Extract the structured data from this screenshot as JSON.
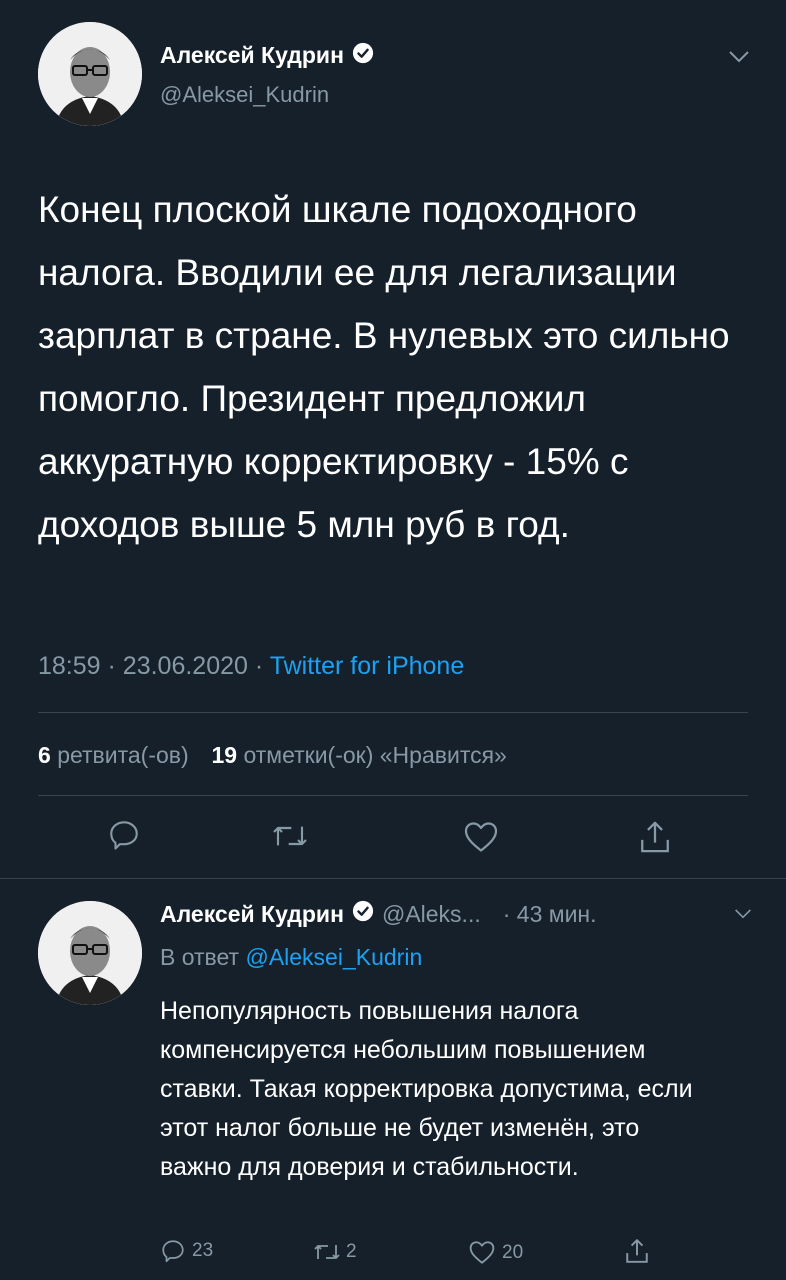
{
  "main_tweet": {
    "author_name": "Алексей Кудрин",
    "handle": "@Aleksei_Kudrin",
    "text": "Конец плоской шкале подоходного налога. Вводили ее для легализации зарплат в стране. В нулевых это сильно помогло. Президент предложил аккуратную корректировку - 15% с доходов выше 5 млн руб в год.",
    "time": "18:59",
    "date": "23.06.2020",
    "source": "Twitter for iPhone",
    "retweet_count": "6",
    "retweet_label": "ретвита(-ов)",
    "like_count": "19",
    "like_label": "отметки(-ок) «Нравится»"
  },
  "reply_tweet": {
    "author_name": "Алексей Кудрин",
    "handle": "@Aleks...",
    "time_ago": "· 43 мин.",
    "reply_to_prefix": "В ответ",
    "reply_to_handle": "@Aleksei_Kudrin",
    "text": "Непопулярность повышения налога компенсируется небольшим повышением ставки. Такая корректировка допустима, если этот налог больше не будет изменён, это важно для доверия и стабильности.",
    "reply_count": "23",
    "retweet_count": "2",
    "like_count": "20"
  },
  "icons": {
    "verified": "verified-badge-icon",
    "chevron": "chevron-down-icon",
    "reply": "reply-icon",
    "retweet": "retweet-icon",
    "like": "heart-icon",
    "share": "share-icon"
  },
  "colors": {
    "background": "#15202b",
    "text": "#ffffff",
    "muted": "#8899a6",
    "link": "#1da1f2",
    "divider": "#38444d"
  }
}
